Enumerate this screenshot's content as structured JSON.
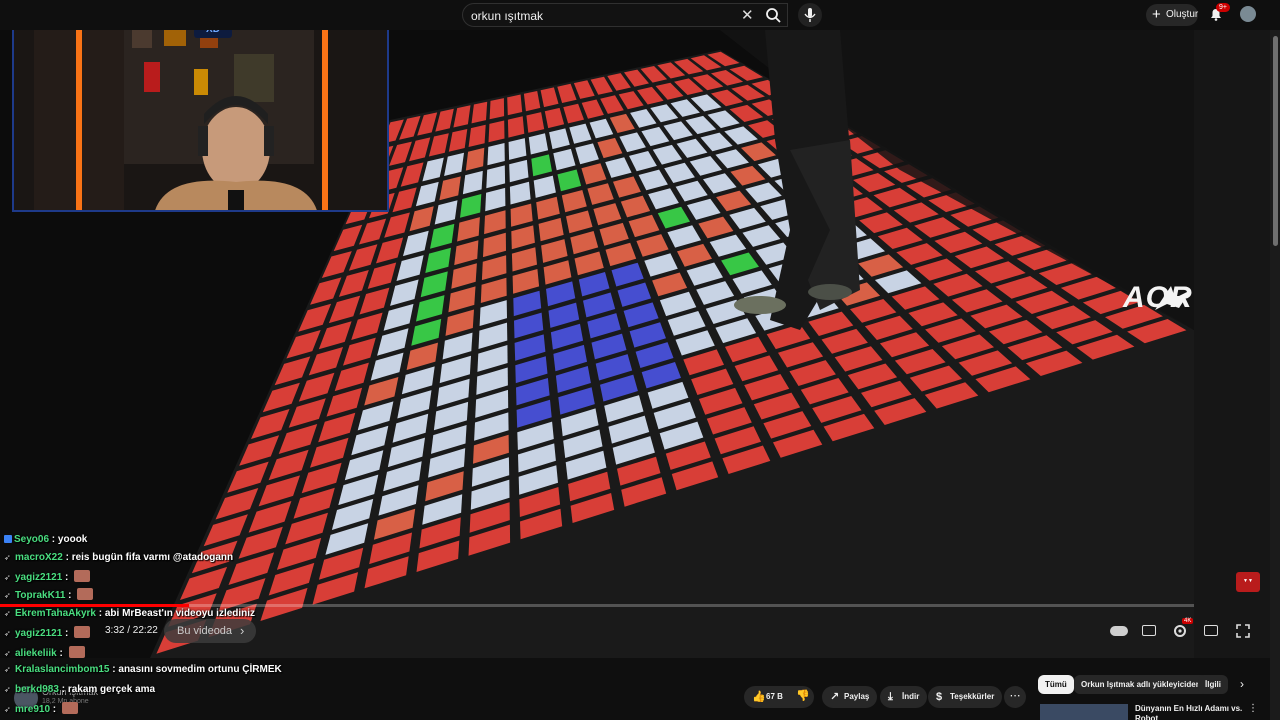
{
  "search": {
    "query": "orkun ışıtmak"
  },
  "header": {
    "create_label": "Oluştur",
    "notification_badge": "9+"
  },
  "player": {
    "current_time": "3:32",
    "duration": "22:22",
    "time_display": "3:32 / 22:22",
    "progress_fraction": 0.158,
    "chapter_label": "Bu videoda",
    "overlay_brand": "AORUS",
    "quality_badge": "4K"
  },
  "chat": [
    {
      "user": "Seyo06",
      "message": "yoook",
      "badges": true
    },
    {
      "user": "macroX22",
      "message": "reis bugün fifa varmı @atadogann"
    },
    {
      "user": "yagiz2121",
      "message": "",
      "emote": true
    },
    {
      "user": "ToprakK11",
      "message": "",
      "emote": true
    },
    {
      "user": "EkremTahaAkyrk",
      "message": "abi MrBeast'ın videoyu izlediniz"
    },
    {
      "user": "yagiz2121",
      "message": "",
      "emote": true
    },
    {
      "user": "aliekeliik",
      "message": "",
      "emote": true
    },
    {
      "user": "Kralaslancimbom15",
      "message": "anasını sovmedim ortunu ÇİRMEK"
    },
    {
      "user": "berkd983",
      "message": "rakam gerçek ama"
    },
    {
      "user": "mre910",
      "message": "",
      "emote": true
    }
  ],
  "channel": {
    "name": "Orkun Işıtmak",
    "subs": "18,2 Mn abone"
  },
  "actions": {
    "like_count": "67 B",
    "share_label": "Paylaş",
    "download_label": "İndir",
    "thanks_label": "Teşekkürler",
    "more_label": "⋯"
  },
  "chips": [
    "Tümü",
    "Orkun Işıtmak adlı yükleyiciden",
    "İlgili"
  ],
  "recommended": {
    "title": "Dünyanın En Hızlı Adamı vs. Robot"
  },
  "colors": {
    "accent_red": "#ff0000",
    "badge_red": "#cc0000",
    "chat_user_green": "#4ade80"
  }
}
